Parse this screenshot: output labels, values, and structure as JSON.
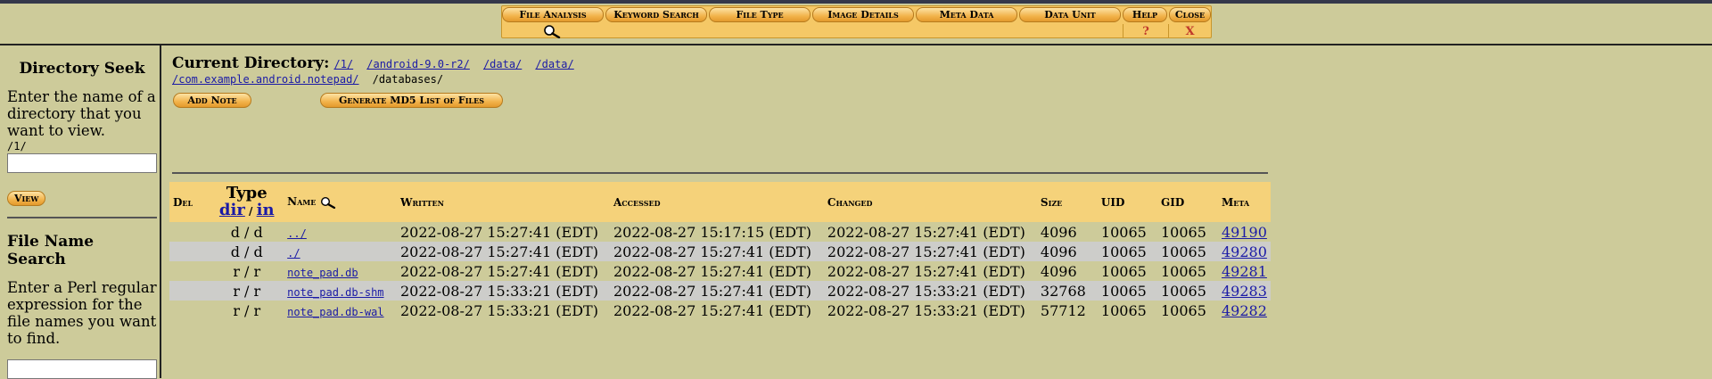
{
  "menu": {
    "file_analysis": "File Analysis",
    "keyword_search": "Keyword Search",
    "file_type": "File Type",
    "image_details": "Image Details",
    "meta_data": "Meta Data",
    "data_unit": "Data Unit",
    "help": "Help",
    "help_symbol": "?",
    "close": "Close",
    "close_symbol": "X"
  },
  "sidebar": {
    "directory_seek": {
      "title": "Directory Seek",
      "instructions": "Enter the name of a directory that you want to view.",
      "current_path": "/1/",
      "input_value": "",
      "view_button": "View"
    },
    "file_name_search": {
      "title": "File Name Search",
      "instructions": "Enter a Perl regular expression for the file names you want to find.",
      "input_value": ""
    }
  },
  "main": {
    "current_dir_label": "Current Directory:",
    "path_links": [
      "/1/",
      "/android-9.0-r2/",
      "/data/",
      "/data/",
      "/com.example.android.notepad/"
    ],
    "path_current": "/databases/",
    "add_note_button": "Add Note",
    "md5_button": "Generate MD5 List of Files"
  },
  "table": {
    "headers": {
      "del": "Del",
      "type": "Type",
      "type_dir": "dir",
      "type_slash": "/",
      "type_in": "in",
      "name": "Name",
      "written": "Written",
      "accessed": "Accessed",
      "changed": "Changed",
      "size": "Size",
      "uid": "UID",
      "gid": "GID",
      "meta": "Meta"
    },
    "rows": [
      {
        "type": "d / d",
        "name": "../",
        "written": "2022-08-27 15:27:41 (EDT)",
        "accessed": "2022-08-27 15:17:15 (EDT)",
        "changed": "2022-08-27 15:27:41 (EDT)",
        "size": "4096",
        "uid": "10065",
        "gid": "10065",
        "meta": "49190"
      },
      {
        "type": "d / d",
        "name": "./",
        "written": "2022-08-27 15:27:41 (EDT)",
        "accessed": "2022-08-27 15:27:41 (EDT)",
        "changed": "2022-08-27 15:27:41 (EDT)",
        "size": "4096",
        "uid": "10065",
        "gid": "10065",
        "meta": "49280"
      },
      {
        "type": "r / r",
        "name": "note_pad.db",
        "written": "2022-08-27 15:27:41 (EDT)",
        "accessed": "2022-08-27 15:27:41 (EDT)",
        "changed": "2022-08-27 15:27:41 (EDT)",
        "size": "4096",
        "uid": "10065",
        "gid": "10065",
        "meta": "49281"
      },
      {
        "type": "r / r",
        "name": "note_pad.db-shm",
        "written": "2022-08-27 15:33:21 (EDT)",
        "accessed": "2022-08-27 15:27:41 (EDT)",
        "changed": "2022-08-27 15:33:21 (EDT)",
        "size": "32768",
        "uid": "10065",
        "gid": "10065",
        "meta": "49283"
      },
      {
        "type": "r / r",
        "name": "note_pad.db-wal",
        "written": "2022-08-27 15:33:21 (EDT)",
        "accessed": "2022-08-27 15:27:41 (EDT)",
        "changed": "2022-08-27 15:33:21 (EDT)",
        "size": "57712",
        "uid": "10065",
        "gid": "10065",
        "meta": "49282"
      }
    ]
  },
  "colors": {
    "page_bg": "#cdcb9a",
    "header_bg": "#f5d27a",
    "alt_row_bg": "#cdcdca",
    "link": "#1a1aa6",
    "button_orange": "#f2b34b"
  },
  "icons": {
    "search": "magnifier-icon"
  }
}
